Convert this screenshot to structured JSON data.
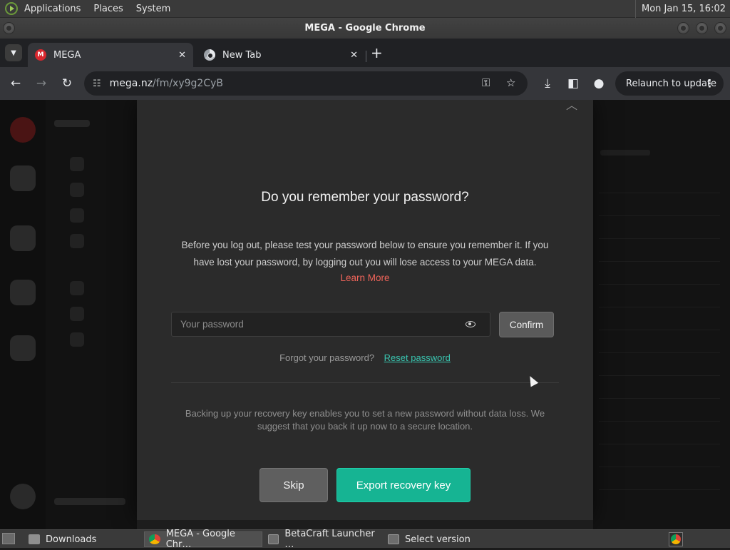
{
  "panel": {
    "menus": [
      "Applications",
      "Places",
      "System"
    ],
    "clock": "Mon Jan 15, 16:02"
  },
  "window": {
    "title": "MEGA - Google Chrome"
  },
  "tabs": [
    {
      "label": "MEGA",
      "favicon": "mega-icon",
      "active": true
    },
    {
      "label": "New Tab",
      "favicon": "chrome-icon",
      "active": false
    }
  ],
  "toolbar": {
    "url_host": "mega.nz",
    "url_path": "/fm/xy9g2CyB",
    "relaunch_label": "Relaunch to update"
  },
  "dialog": {
    "title": "Do you remember your password?",
    "description": "Before you log out, please test your password below to ensure you remember it. If you have lost your password, by logging out you will lose access to your MEGA data.",
    "learn_more": "Learn More",
    "password_placeholder": "Your password",
    "password_value": "",
    "confirm_label": "Confirm",
    "forgot_text": "Forgot your password?",
    "reset_link": "Reset password",
    "backup_text": "Backing up your recovery key enables you to set a new password without data loss. We suggest that you back it up now to a secure location.",
    "skip_label": "Skip",
    "export_label": "Export recovery key"
  },
  "taskbar": {
    "items": [
      {
        "label": "Downloads",
        "icon": "folder-icon",
        "active": false
      },
      {
        "label": "MEGA - Google Chr…",
        "icon": "chrome-icon",
        "active": true
      },
      {
        "label": "BetaCraft Launcher …",
        "icon": "app-icon",
        "active": false
      },
      {
        "label": "Select version",
        "icon": "app-icon",
        "active": false
      }
    ]
  },
  "colors": {
    "accent_teal": "#16b493",
    "link_red": "#f0645a",
    "link_teal": "#39c5b0",
    "dialog_bg": "#2b2b2b"
  }
}
